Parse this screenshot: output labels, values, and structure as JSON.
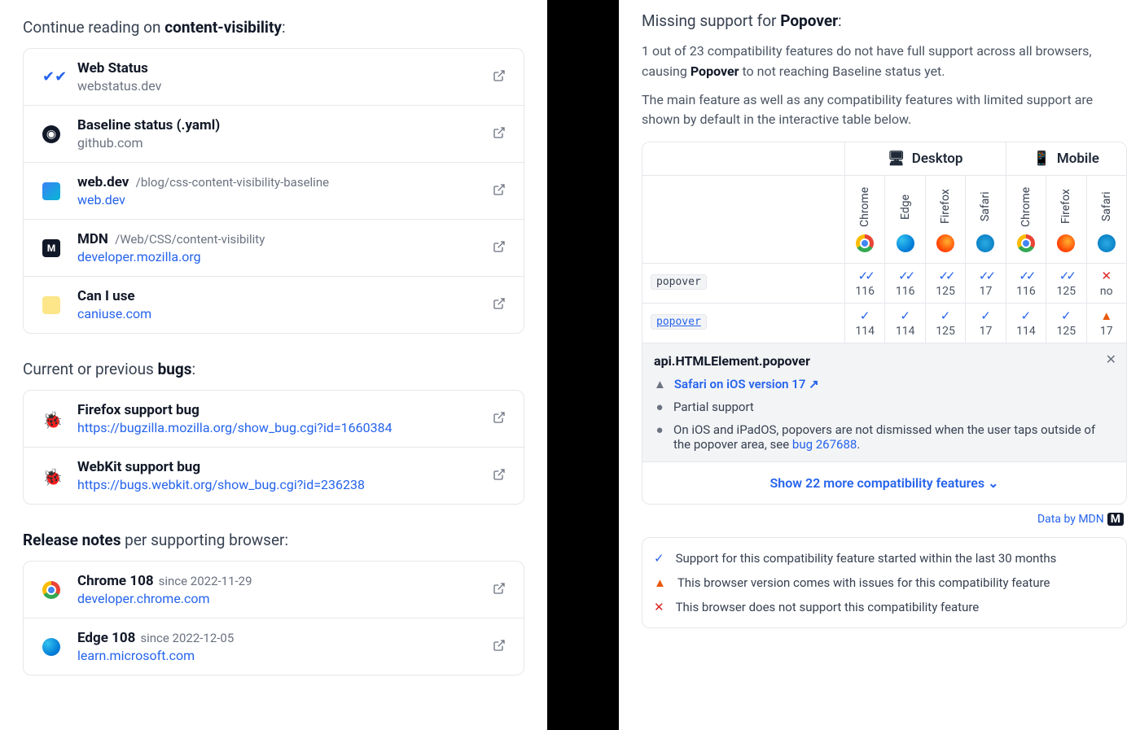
{
  "left": {
    "continue_heading_prefix": "Continue reading on ",
    "continue_heading_bold": "content-visibility",
    "continue_heading_suffix": ":",
    "resources": [
      {
        "icon": "webstatus",
        "title": "Web Status",
        "path": "",
        "sub": "webstatus.dev",
        "sub_link": false
      },
      {
        "icon": "github",
        "title": "Baseline status (.yaml)",
        "path": "",
        "sub": "github.com",
        "sub_link": false
      },
      {
        "icon": "webdev",
        "title": "web.dev",
        "path": "/blog/css-content-visibility-baseline",
        "sub": "web.dev",
        "sub_link": true
      },
      {
        "icon": "mdn",
        "title": "MDN",
        "path": "/Web/CSS/content-visibility",
        "sub": "developer.mozilla.org",
        "sub_link": true
      },
      {
        "icon": "caniuse",
        "title": "Can I use",
        "path": "",
        "sub": "caniuse.com",
        "sub_link": true
      }
    ],
    "bugs_heading_prefix": "Current or previous ",
    "bugs_heading_bold": "bugs",
    "bugs_heading_suffix": ":",
    "bugs": [
      {
        "title": "Firefox support bug",
        "url": "https://bugzilla.mozilla.org/show_bug.cgi?id=1660384"
      },
      {
        "title": "WebKit support bug",
        "url": "https://bugs.webkit.org/show_bug.cgi?id=236238"
      }
    ],
    "release_heading_bold": "Release notes",
    "release_heading_suffix": " per supporting browser:",
    "releases": [
      {
        "icon": "chrome",
        "title": "Chrome 108",
        "since": "since 2022-11-29",
        "sub": "developer.chrome.com"
      },
      {
        "icon": "edge",
        "title": "Edge 108",
        "since": "since 2022-12-05",
        "sub": "learn.microsoft.com"
      }
    ]
  },
  "right": {
    "heading_prefix": "Missing support for ",
    "heading_bold": "Popover",
    "heading_suffix": ":",
    "para1_a": "1 out of 23 compatibility features do not have full support across all browsers, causing ",
    "para1_bold": "Popover",
    "para1_b": " to not reaching Baseline status yet.",
    "para2": "The main feature as well as any compatibility features with limited support are shown by default in the interactive table below.",
    "groups": {
      "desktop": "Desktop",
      "mobile": "Mobile"
    },
    "columns": [
      {
        "name": "Chrome",
        "icon": "chrome"
      },
      {
        "name": "Edge",
        "icon": "edge"
      },
      {
        "name": "Firefox",
        "icon": "firefox"
      },
      {
        "name": "Safari",
        "icon": "safari"
      },
      {
        "name": "Chrome",
        "icon": "chrome"
      },
      {
        "name": "Firefox",
        "icon": "firefox"
      },
      {
        "name": "Safari",
        "icon": "safari"
      }
    ],
    "rows": [
      {
        "label": "popover",
        "link": false,
        "cells": [
          {
            "m": "dbl",
            "v": "116"
          },
          {
            "m": "dbl",
            "v": "116"
          },
          {
            "m": "dbl",
            "v": "125"
          },
          {
            "m": "dbl",
            "v": "17"
          },
          {
            "m": "dbl",
            "v": "116"
          },
          {
            "m": "dbl",
            "v": "125"
          },
          {
            "m": "x",
            "v": "no"
          }
        ]
      },
      {
        "label": "popover",
        "link": true,
        "cells": [
          {
            "m": "check",
            "v": "114"
          },
          {
            "m": "check",
            "v": "114"
          },
          {
            "m": "check",
            "v": "125"
          },
          {
            "m": "check",
            "v": "17"
          },
          {
            "m": "check",
            "v": "114"
          },
          {
            "m": "check",
            "v": "125"
          },
          {
            "m": "warn",
            "v": "17"
          }
        ]
      }
    ],
    "detail": {
      "title": "api.HTMLElement.popover",
      "warn_line": "Safari on iOS version 17",
      "partial": "Partial support",
      "note_a": "On iOS and iPadOS, popovers are not dismissed when the user taps outside of the popover area, see ",
      "note_link": "bug 267688",
      "note_b": "."
    },
    "show_more": "Show 22 more compatibility features",
    "data_by": "Data by MDN",
    "legend": [
      {
        "m": "check",
        "t": "Support for this compatibility feature started within the last 30 months"
      },
      {
        "m": "warn",
        "t": "This browser version comes with issues for this compatibility feature"
      },
      {
        "m": "x",
        "t": "This browser does not support this compatibility feature"
      }
    ]
  }
}
